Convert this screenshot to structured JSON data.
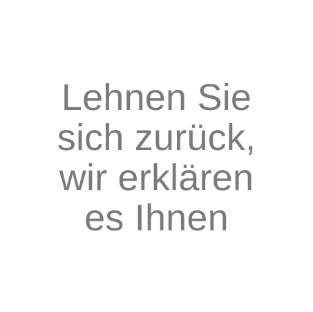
{
  "headline": {
    "lines": [
      "Lehnen Sie",
      "sich zurück,",
      "wir erklären",
      "es Ihnen"
    ],
    "color": "#7a7a7a"
  },
  "background": "#ffffff"
}
